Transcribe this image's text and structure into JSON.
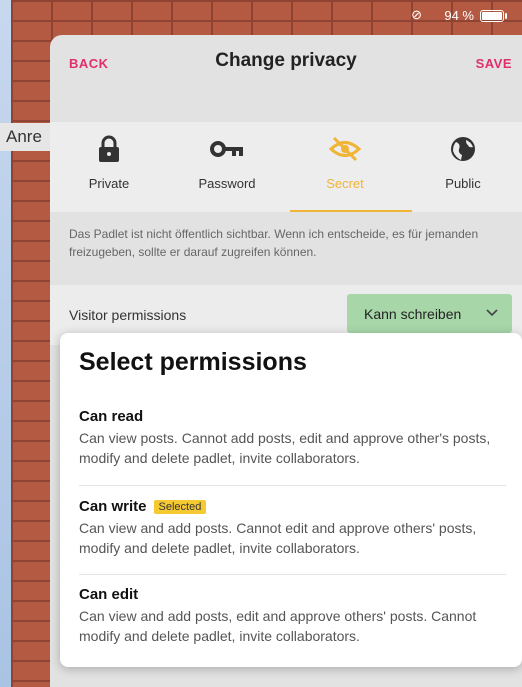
{
  "status": {
    "battery_text": "94 %",
    "battery_level": 0.94
  },
  "background": {
    "behind_text": "Anre"
  },
  "header": {
    "back_label": "BACK",
    "title": "Change privacy",
    "save_label": "SAVE"
  },
  "privacy_options": [
    {
      "label": "Private",
      "icon": "lock-icon",
      "selected": false
    },
    {
      "label": "Password",
      "icon": "key-icon",
      "selected": false
    },
    {
      "label": "Secret",
      "icon": "eye-off-icon",
      "selected": true
    },
    {
      "label": "Public",
      "icon": "globe-icon",
      "selected": false
    }
  ],
  "description": "Das Padlet ist nicht öffentlich sichtbar. Wenn ich entscheide, es für jemanden freizugeben, sollte er darauf zugreifen können.",
  "permissions": {
    "label": "Visitor permissions",
    "value": "Kann schreiben"
  },
  "popup": {
    "title": "Select permissions",
    "items": [
      {
        "name": "Can read",
        "desc": "Can view posts. Cannot add posts, edit and approve other's posts, modify and delete padlet, invite collaborators.",
        "badge": ""
      },
      {
        "name": "Can write",
        "desc": "Can view and add posts. Cannot edit and approve others' posts, modify and delete padlet, invite collaborators.",
        "badge": "Selected"
      },
      {
        "name": "Can edit",
        "desc": "Can view and add posts, edit and approve others' posts. Cannot modify and delete padlet, invite collaborators.",
        "badge": ""
      }
    ]
  },
  "colors": {
    "accent": "#e0306a",
    "selected": "#f0b436",
    "permission_bg": "#a7d7a9"
  }
}
